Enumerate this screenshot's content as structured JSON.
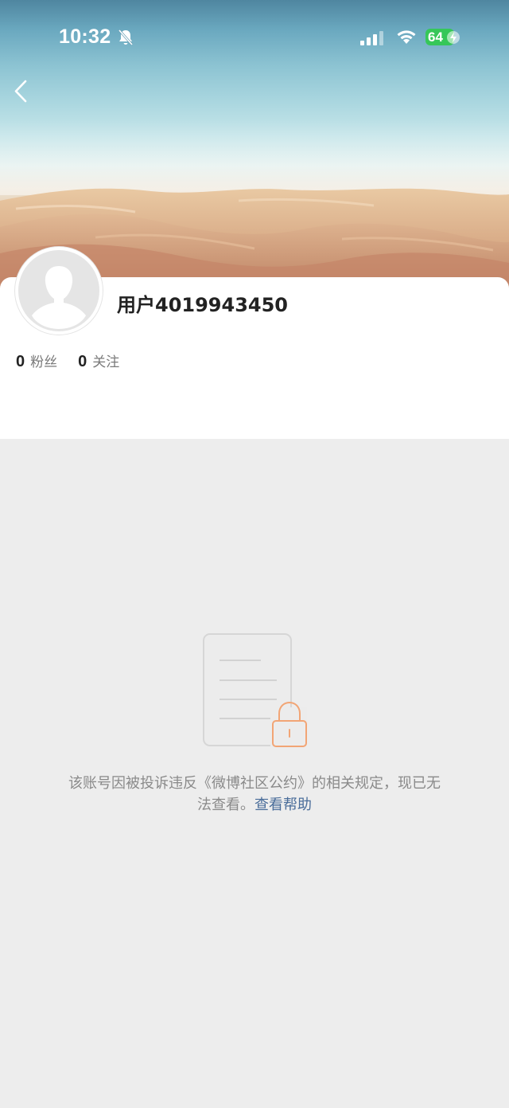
{
  "status_bar": {
    "time": "10:32",
    "battery_level": "64",
    "battery_color": "#36c759"
  },
  "navigation": {
    "back_icon": "chevron-left-icon"
  },
  "profile": {
    "username": "用户4019943450",
    "avatar_icon": "default-avatar-icon",
    "stats": {
      "followers_count": "0",
      "followers_label": "粉丝",
      "following_count": "0",
      "following_label": "关注"
    }
  },
  "blocked_notice": {
    "illustration_icon": "locked-document-icon",
    "message_line1": "该账号因被投诉违反《微博社区公约》的相关规定，现已无",
    "message_line2_prefix": "法查看。",
    "help_link_label": "查看帮助",
    "link_color": "#4a6d9a",
    "lock_color": "#f2a575"
  }
}
